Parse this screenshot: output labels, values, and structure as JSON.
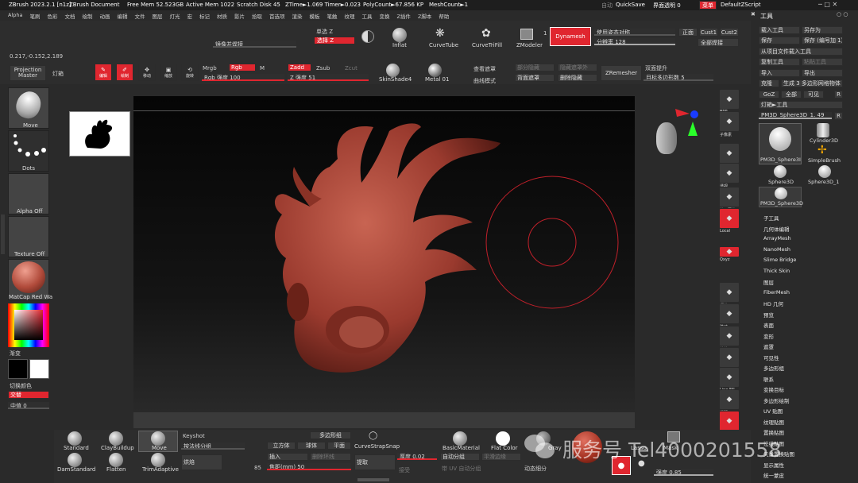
{
  "title_bar": {
    "app": "ZBrush 2023.2.1 [n1z]",
    "doc": "ZBrush Document",
    "free_mem": "Free Mem 52.523GB",
    "active_mem": "Active Mem 1022",
    "scratch": "Scratch Disk 45",
    "ztime": "ZTime►1.069 Timer►0.023",
    "polycount": "PolyCount►67.856 KP",
    "meshcount": "MeshCount►1",
    "auto": "自动",
    "quicksave": "QuickSave",
    "ui_opacity": "界面透明 0",
    "menu": "菜单",
    "script": "DefaultZScript"
  },
  "menu_items": [
    "Alpha",
    "笔刷",
    "色彩",
    "文档",
    "绘制",
    "动画",
    "编辑",
    "文件",
    "图层",
    "灯光",
    "宏",
    "标记",
    "材质",
    "影片",
    "拾取",
    "首选项",
    "渲染",
    "模板",
    "笔触",
    "纹理",
    "工具",
    "变换",
    "Z插件",
    "Z脚本",
    "帮助"
  ],
  "coords": "0.217,-0.152,2.189",
  "top_shelf": {
    "lens": "镜像并焊接",
    "single": "单选 Z",
    "select_z": "选择 Z",
    "inflat": "Inflat",
    "curvetube": "CurveTube",
    "curvetrifill": "CurveTriFill",
    "zmodeler": "ZModeler",
    "zmodeler_num": "1",
    "dynamesh": "Dynamesh",
    "use_pose": "使用姿态对称",
    "front": "正面",
    "cust1": "Cust1",
    "cust2": "Cust2",
    "resolution": "分辨率 128",
    "all_weld": "全部焊接"
  },
  "draw_bar": {
    "projection_master": "Projection Master",
    "lightbox": "灯箱",
    "edit": "编辑",
    "draw": "绘制",
    "move": "移动",
    "scale": "缩放",
    "rotate": "旋转",
    "mrgb": "Mrgb",
    "rgb": "Rgb",
    "m": "M",
    "zadd": "Zadd",
    "zsub": "Zsub",
    "zcut": "Zcut",
    "rgb_intensity": "Rgb 强度 100",
    "z_intensity": "Z 强度 51",
    "skinshade": "SkinShade4",
    "metal": "Metal 01",
    "view_mask": "查看遮罩",
    "curve_mode": "曲线模式",
    "partial_hide": "部分隐藏",
    "back_mask": "背面遮罩",
    "hide_unmasked": "隐藏遮罩外",
    "delete_hidden": "删除隐藏",
    "zremesher": "ZRemesher",
    "double_lift": "双面提升",
    "target_poly": "目标多边形数 5"
  },
  "left_panel": {
    "move": "Move",
    "dots": "Dots",
    "alpha_off": "Alpha Off",
    "texture_off": "Texture Off",
    "matcap": "MatCap Red Wa",
    "gradient": "渐变",
    "switch_color": "切换颜色",
    "alternate": "交替",
    "midvalue": "中值 0"
  },
  "right_shelf": {
    "bpr": "BPR",
    "subpix": "子像素",
    "zoom": "100%",
    "aahalf": "AAHalf",
    "dynamic": "Dynamic",
    "persp": "透视",
    "floor": "地面网格",
    "local": "Local",
    "dynamic2": "Dynamic",
    "xyz": "Qxyz",
    "frame": "框选",
    "move": "移动",
    "scale": "缩放",
    "rotate": "旋转",
    "linefill": "Line Fill",
    "polyf": "PolyF",
    "transp": "透明",
    "ghost": "Ghost",
    "solo": "Solo",
    "xpose": "Xpose"
  },
  "tool_panel": {
    "header": "工具",
    "load": "载入工具",
    "save_as": "另存为",
    "save": "保存",
    "save_inc": "保存 (编号加 1)",
    "load_from_proj": "从项目文件载入工具",
    "copy": "复制工具",
    "paste": "粘贴工具",
    "import": "导入",
    "export": "导出",
    "clone": "克隆",
    "make_poly": "生成 3 多边形网格物体",
    "goz": "GoZ",
    "all": "全部",
    "visible": "可见",
    "r": "R",
    "lightbox_tool": "灯箱►工具",
    "current_tool": "PM3D_Sphere3D_1. 49",
    "r2": "R",
    "thumbs": [
      "PM3D_Sphere3I",
      "Cylinder3D",
      "SimpleBrush",
      "Sphere3D",
      "Sphere3D_1",
      "PM3D_Sphere3D"
    ],
    "subtools": [
      "子工具",
      "几何体编辑",
      "ArrayMesh",
      "NanoMesh",
      "Slime Bridge",
      "Thick Skin",
      "图层",
      "FiberMesh",
      "HD 几何",
      "预览",
      "表面",
      "变形",
      "遮罩",
      "可见性",
      "多边形组",
      "联系",
      "变换目标",
      "多边形绘制",
      "UV 贴图",
      "纹理贴图",
      "置换贴图",
      "法线贴图",
      "矢量置换贴图",
      "显示属性",
      "统一蒙皮"
    ]
  },
  "bottom_shelf": {
    "standard": "Standard",
    "claybuildup": "ClayBuildup",
    "move": "Move",
    "damstandard": "DamStandard",
    "flatten": "Flatten",
    "trimadaptive": "TrimAdaptive",
    "keyshot": "Keyshot",
    "by_normal": "按法线分组",
    "bake": "烘焙",
    "poly_group": "多边形组",
    "cube": "立方体",
    "sphere": "球体",
    "plane": "平面",
    "insert": "插入",
    "delete_loop": "删除环线",
    "focal": "焦距(mm) 50",
    "focal_num": "85",
    "curvestrapsnap": "CurveStrapSnap",
    "extract": "提取",
    "thickness": "厚度 0.02",
    "auto_group": "自动分组",
    "smooth_edge": "平滑边缘",
    "accept": "接受",
    "uv_auto": "带 UV 自动分组",
    "dynamic_sub": "动态细分",
    "basicmaterial": "BasicMaterial",
    "flatcolor": "Flat Color",
    "gray": "Gray",
    "lasso": "Lasso",
    "mask": "Mask",
    "strength": "强度 0.85"
  },
  "watermark": "服务号 Tel4000201558",
  "colors": {
    "accent": "#e0262f",
    "bg": "#2a2a2a",
    "model": "#9a3a2e"
  }
}
